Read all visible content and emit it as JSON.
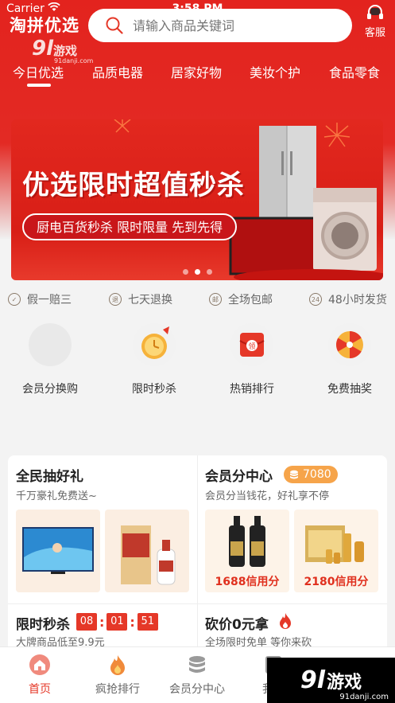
{
  "status_bar": {
    "carrier": "Carrier",
    "time": "3:58 PM"
  },
  "header": {
    "app_title": "淘拼优选",
    "search_placeholder": "请输入商品关键词",
    "service_label": "客服"
  },
  "watermark_top": {
    "brand": "9l",
    "text": "游戏",
    "site": "91danji.com"
  },
  "tabs": [
    {
      "label": "今日优选",
      "active": true
    },
    {
      "label": "品质电器"
    },
    {
      "label": "居家好物"
    },
    {
      "label": "美妆个护"
    },
    {
      "label": "食品零食"
    }
  ],
  "banner": {
    "title": "优选限时超值秒杀",
    "subtitle": "厨电百货秒杀 限时限量 先到先得",
    "slide_count": 3,
    "active_slide": 2
  },
  "guarantees": [
    {
      "label": "假一赔三",
      "icon": "shield-icon"
    },
    {
      "label": "七天退换",
      "icon": "return-icon"
    },
    {
      "label": "全场包邮",
      "icon": "free-shipping-icon"
    },
    {
      "label": "48小时发货",
      "icon": "24h-icon",
      "icon_text": "24"
    }
  ],
  "entries": [
    {
      "label": "会员分换购",
      "icon": "placeholder-icon"
    },
    {
      "label": "限时秒杀",
      "icon": "clock-icon"
    },
    {
      "label": "热销排行",
      "icon": "red-envelope-icon",
      "icon_text": "领"
    },
    {
      "label": "免费抽奖",
      "icon": "prize-wheel-icon"
    }
  ],
  "promo": {
    "lottery": {
      "title": "全民抽好礼",
      "subtitle": "千万豪礼免费送~"
    },
    "points": {
      "title": "会员分中心",
      "balance": "7080",
      "subtitle": "会员分当钱花，好礼享不停",
      "items": [
        {
          "caption": "1688信用分"
        },
        {
          "caption": "2180信用分"
        }
      ]
    },
    "flash": {
      "title": "限时秒杀",
      "subtitle": "大牌商品低至9.9元",
      "hours": "08",
      "minutes": "01",
      "seconds": "51"
    },
    "bargain": {
      "title": "砍价0元拿",
      "subtitle": "全场限时免单 等你来砍"
    }
  },
  "bottom_nav": [
    {
      "label": "首页",
      "active": true,
      "icon": "home-icon"
    },
    {
      "label": "疯抢排行",
      "icon": "flame-icon"
    },
    {
      "label": "会员分中心",
      "icon": "coins-icon"
    },
    {
      "label": "我的",
      "icon": "user-icon"
    }
  ],
  "watermark_bottom": {
    "brand": "9l",
    "text": "游戏",
    "site": "91danji.com"
  },
  "colors": {
    "brand_red": "#e3231e",
    "accent_orange": "#f6a44a",
    "text_dark": "#333333"
  }
}
